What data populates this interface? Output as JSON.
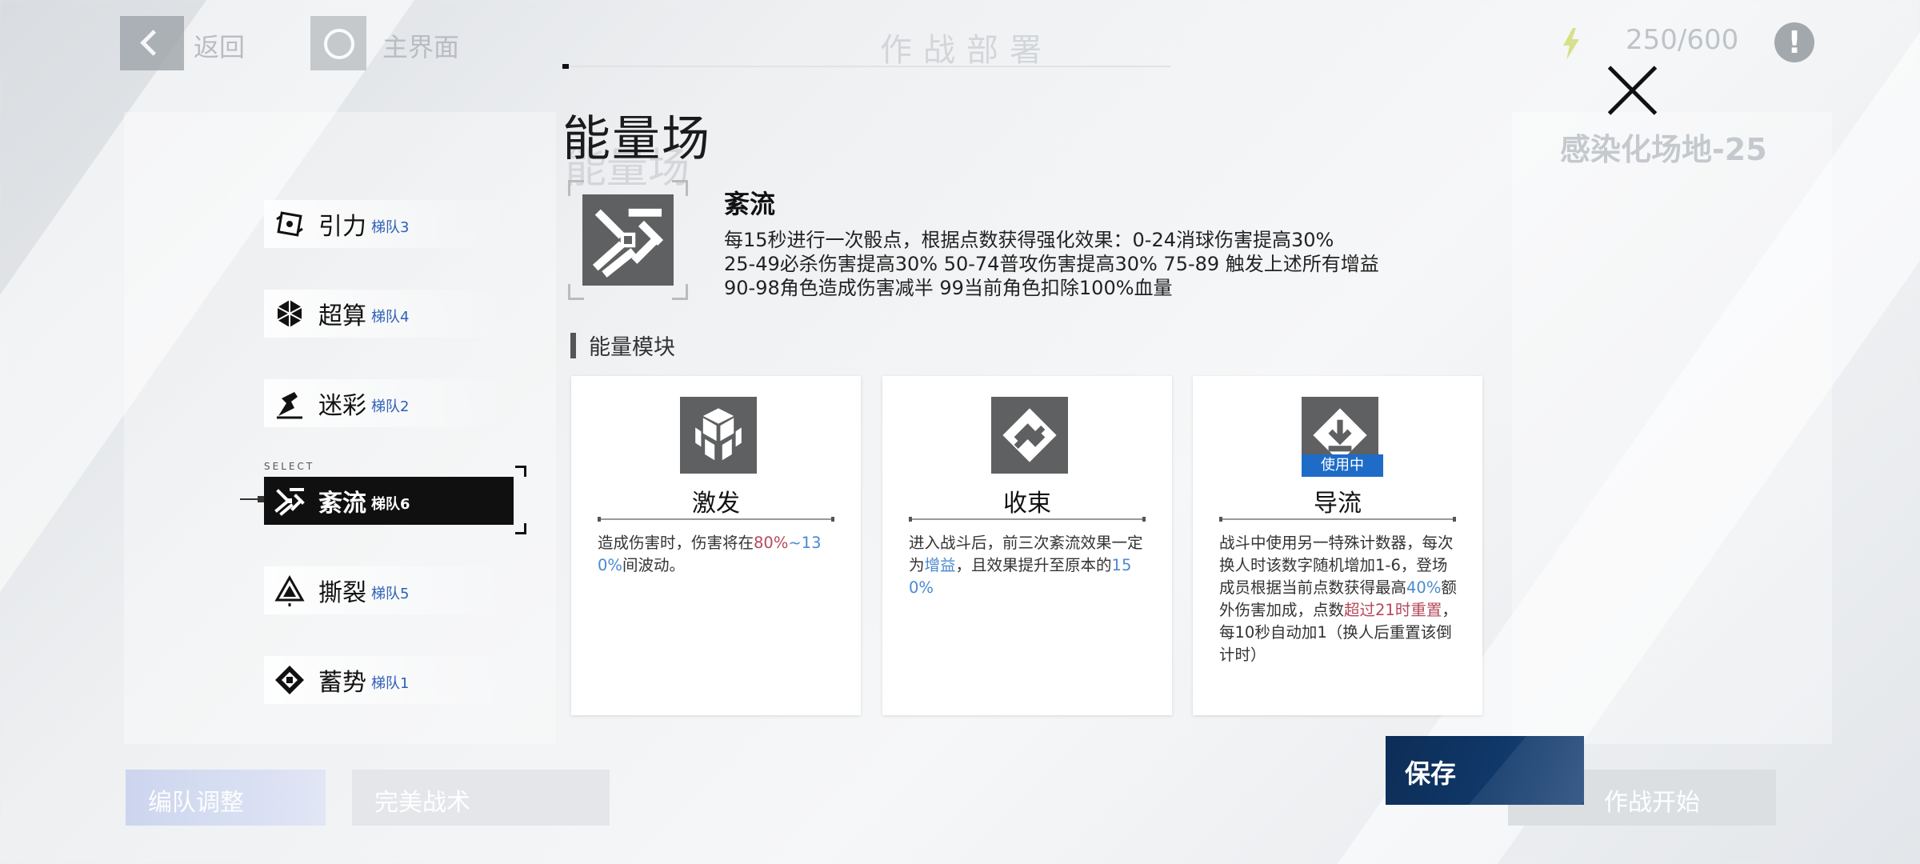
{
  "topbar": {
    "back_label": "返回",
    "home_label": "主界面",
    "page_title": "作战部署",
    "energy": "250/600",
    "info_symbol": "!"
  },
  "background": {
    "right_title": "感染化场地-25",
    "bottom_left_button": "编队调整",
    "bottom_mid_button": "完美战术",
    "bottom_right_button": "作战开始"
  },
  "popup": {
    "title": "能量场",
    "title_shadow": "能量场",
    "select_label": "SELECT",
    "fields": [
      {
        "name": "引力",
        "team": "梯队3",
        "icon": "gravity-icon"
      },
      {
        "name": "超算",
        "team": "梯队4",
        "icon": "supercompute-icon"
      },
      {
        "name": "迷彩",
        "team": "梯队2",
        "icon": "camouflage-icon"
      },
      {
        "name": "紊流",
        "team": "梯队6",
        "icon": "turbulence-icon"
      },
      {
        "name": "撕裂",
        "team": "梯队5",
        "icon": "tear-icon"
      },
      {
        "name": "蓄势",
        "team": "梯队1",
        "icon": "charge-icon"
      }
    ],
    "selected_index": 3,
    "detail": {
      "name": "紊流",
      "icon": "turbulence-icon",
      "description": "每15秒进行一次骰点，根据点数获得强化效果：0-24消球伤害提高30%\n25-49必杀伤害提高30% 50-74普攻伤害提高30% 75-89 触发上述所有增益\n90-98角色造成伤害减半 99当前角色扣除100%血量"
    },
    "module_section_title": "能量模块",
    "modules": [
      {
        "name": "激发",
        "icon": "cubes-icon",
        "desc_parts": [
          "造成伤害时，伤害将在",
          "80%",
          "~",
          "130%",
          "间波动。"
        ]
      },
      {
        "name": "收束",
        "icon": "converge-icon",
        "desc_parts": [
          "进入战斗后，前三次紊流效果一定为",
          "增益",
          "，且效果提升至原本的",
          "150%"
        ]
      },
      {
        "name": "导流",
        "icon": "diversion-icon",
        "in_use_label": "使用中",
        "desc_parts": [
          "战斗中使用另一特殊计数器，每次换人时该数字随机增加1-6，登场成员根据当前点数获得最高",
          "40%",
          "额外伤害加成，点数",
          "超过21时重置",
          "，每10秒自动加1（换人后重置该倒计时）"
        ]
      }
    ],
    "save_label": "保存"
  },
  "colors": {
    "accent_blue": "#1e6cc8",
    "highlight_red": "#b5485a",
    "highlight_blue": "#4a8ad0",
    "save_button": "#103869"
  }
}
